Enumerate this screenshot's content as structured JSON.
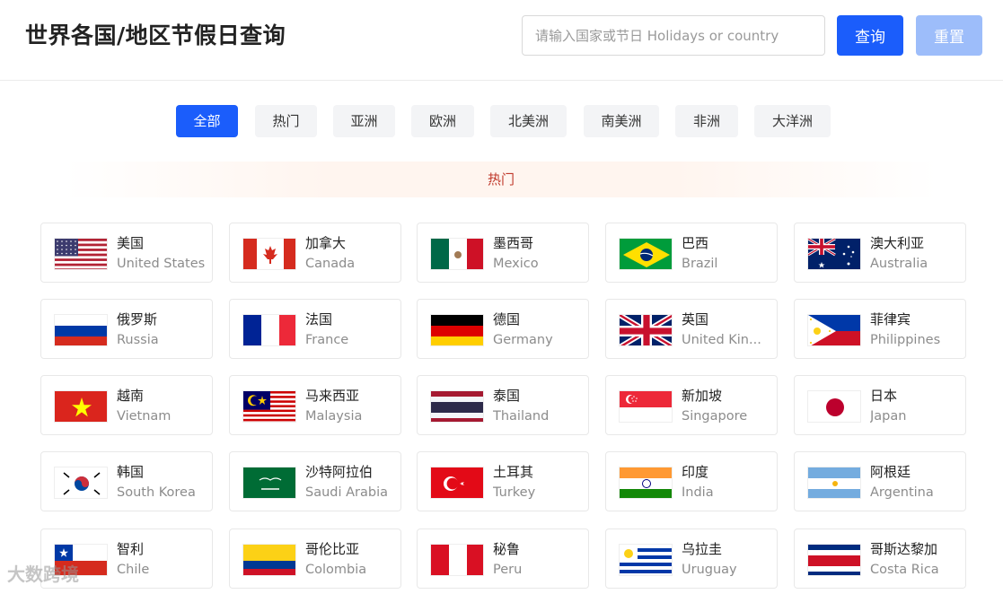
{
  "header": {
    "title": "世界各国/地区节假日查询",
    "search_placeholder": "请输入国家或节日 Holidays or country",
    "search_value": "",
    "search_button": "查询",
    "reset_button": "重置"
  },
  "tabs": [
    {
      "label": "全部",
      "active": true
    },
    {
      "label": "热门",
      "active": false
    },
    {
      "label": "亚洲",
      "active": false
    },
    {
      "label": "欧洲",
      "active": false
    },
    {
      "label": "北美洲",
      "active": false
    },
    {
      "label": "南美洲",
      "active": false
    },
    {
      "label": "非洲",
      "active": false
    },
    {
      "label": "大洋洲",
      "active": false
    }
  ],
  "section": {
    "title": "热门"
  },
  "countries": [
    {
      "cn": "美国",
      "en": "United States",
      "flag": "us-flag"
    },
    {
      "cn": "加拿大",
      "en": "Canada",
      "flag": "canada-flag"
    },
    {
      "cn": "墨西哥",
      "en": "Mexico",
      "flag": "mexico-flag"
    },
    {
      "cn": "巴西",
      "en": "Brazil",
      "flag": "brazil-flag"
    },
    {
      "cn": "澳大利亚",
      "en": "Australia",
      "flag": "australia-flag"
    },
    {
      "cn": "俄罗斯",
      "en": "Russia",
      "flag": "russia-flag"
    },
    {
      "cn": "法国",
      "en": "France",
      "flag": "france-flag"
    },
    {
      "cn": "德国",
      "en": "Germany",
      "flag": "germany-flag"
    },
    {
      "cn": "英国",
      "en": "United Kin...",
      "flag": "uk-flag"
    },
    {
      "cn": "菲律宾",
      "en": "Philippines",
      "flag": "philippines-flag"
    },
    {
      "cn": "越南",
      "en": "Vietnam",
      "flag": "vietnam-flag"
    },
    {
      "cn": "马来西亚",
      "en": "Malaysia",
      "flag": "malaysia-flag"
    },
    {
      "cn": "泰国",
      "en": "Thailand",
      "flag": "thailand-flag"
    },
    {
      "cn": "新加坡",
      "en": "Singapore",
      "flag": "singapore-flag"
    },
    {
      "cn": "日本",
      "en": "Japan",
      "flag": "japan-flag"
    },
    {
      "cn": "韩国",
      "en": "South Korea",
      "flag": "south-korea-flag"
    },
    {
      "cn": "沙特阿拉伯",
      "en": "Saudi Arabia",
      "flag": "saudi-arabia-flag"
    },
    {
      "cn": "土耳其",
      "en": "Turkey",
      "flag": "turkey-flag"
    },
    {
      "cn": "印度",
      "en": "India",
      "flag": "india-flag"
    },
    {
      "cn": "阿根廷",
      "en": "Argentina",
      "flag": "argentina-flag"
    },
    {
      "cn": "智利",
      "en": "Chile",
      "flag": "chile-flag"
    },
    {
      "cn": "哥伦比亚",
      "en": "Colombia",
      "flag": "colombia-flag"
    },
    {
      "cn": "秘鲁",
      "en": "Peru",
      "flag": "peru-flag"
    },
    {
      "cn": "乌拉圭",
      "en": "Uruguay",
      "flag": "uruguay-flag"
    },
    {
      "cn": "哥斯达黎加",
      "en": "Costa Rica",
      "flag": "costa-rica-flag"
    }
  ],
  "watermark": "大数跨境",
  "colors": {
    "primary": "#1b5dfb",
    "primary_disabled": "#9dbdfa",
    "section_title": "#c0392b"
  }
}
